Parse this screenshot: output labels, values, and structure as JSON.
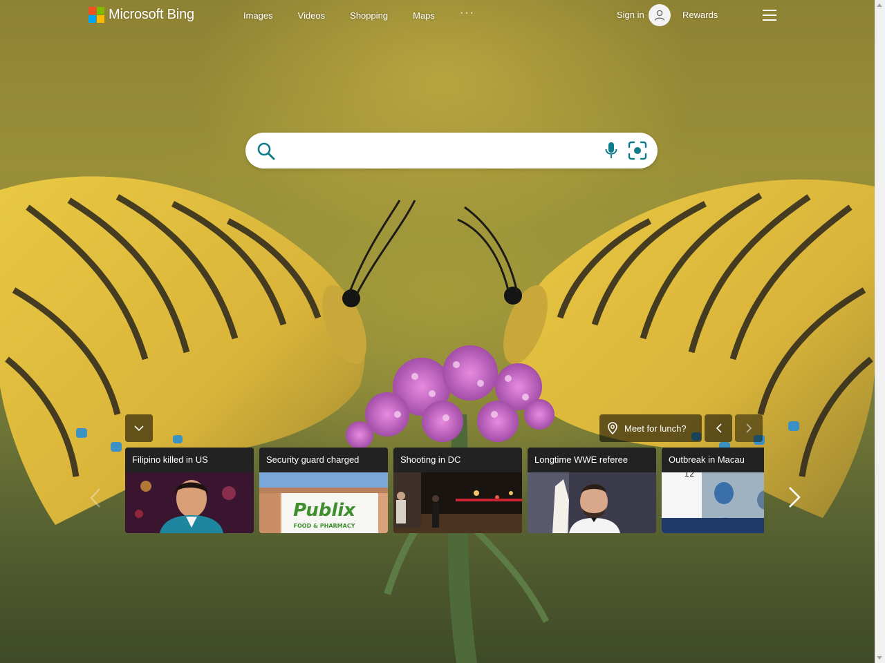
{
  "header": {
    "logo_text": "Microsoft Bing",
    "nav": [
      "Images",
      "Videos",
      "Shopping",
      "Maps"
    ],
    "more_label": "···",
    "signin_label": "Sign in",
    "rewards_label": "Rewards"
  },
  "search": {
    "value": "",
    "placeholder": ""
  },
  "news": {
    "meet_label": "Meet for lunch?",
    "cards": [
      {
        "title": "Filipino killed in US"
      },
      {
        "title": "Security guard charged"
      },
      {
        "title": "Shooting in DC"
      },
      {
        "title": "Longtime WWE referee"
      },
      {
        "title": "Outbreak in Macau"
      }
    ]
  },
  "thumbs": {
    "publix_sign": "Publix",
    "publix_sub": "FOOD & PHARMACY",
    "macau_sign": "12"
  },
  "colors": {
    "bing_teal": "#0f7c8a",
    "overlay": "rgba(0,0,0,0.55)"
  }
}
